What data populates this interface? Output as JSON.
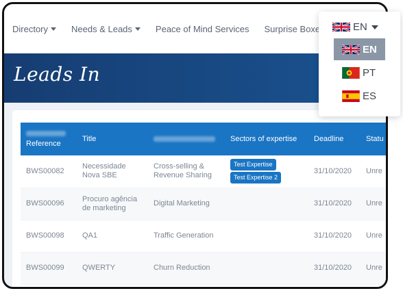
{
  "nav": {
    "items": [
      {
        "label": "Directory",
        "dropdown": true
      },
      {
        "label": "Needs & Leads",
        "dropdown": true
      },
      {
        "label": "Peace of Mind Services",
        "dropdown": false
      },
      {
        "label": "Surprise Boxes",
        "dropdown": false
      }
    ]
  },
  "language": {
    "current": "EN",
    "options": [
      {
        "code": "EN",
        "flag": "uk-flag-icon",
        "active": true
      },
      {
        "code": "PT",
        "flag": "portugal-flag-icon",
        "active": false
      },
      {
        "code": "ES",
        "flag": "spain-flag-icon",
        "active": false
      }
    ]
  },
  "banner": {
    "title": "Leads In"
  },
  "table": {
    "headers": {
      "reference": "Reference",
      "title": "Title",
      "sectors": "Sectors of expertise",
      "deadline": "Deadline",
      "status": "Statu"
    },
    "rows": [
      {
        "reference": "BWS00082",
        "title": "Necessidade Nova SBE",
        "category": "Cross-selling & Revenue Sharing",
        "tags": [
          "Test Expertise",
          "Test Expertise 2"
        ],
        "deadline": "31/10/2020",
        "status": "Unre"
      },
      {
        "reference": "BWS00096",
        "title": "Procuro agência de marketing",
        "category": "Digital Marketing",
        "tags": [],
        "deadline": "31/10/2020",
        "status": "Unre"
      },
      {
        "reference": "BWS00098",
        "title": "QA1",
        "category": "Traffic Generation",
        "tags": [],
        "deadline": "31/10/2020",
        "status": "Unre"
      },
      {
        "reference": "BWS00099",
        "title": "QWERTY",
        "category": "Churn Reduction",
        "tags": [],
        "deadline": "31/10/2020",
        "status": "Unre"
      }
    ]
  },
  "colors": {
    "banner": "#1a5391",
    "table_header": "#1a75c4",
    "active_lang": "#8b97a6"
  }
}
